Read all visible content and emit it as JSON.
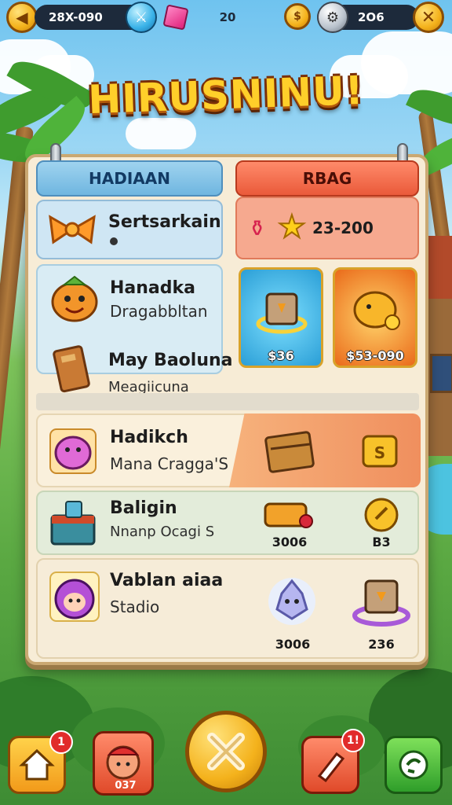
{
  "topbar": {
    "left_value": "28X-090",
    "center_value": "20",
    "right_value": "2O6"
  },
  "title": "HIRUSNINU!",
  "tabs": {
    "left": "HADIAAN",
    "right": "RBAG"
  },
  "featured": {
    "name": "Sertsarkain",
    "stars_value": "23-200"
  },
  "list_left": [
    {
      "name": "Hanadka",
      "sub": "Dragabbltan"
    },
    {
      "name": "May Baoluna",
      "sub": "Meagiicuna"
    }
  ],
  "shop_tiles": [
    {
      "price": "$36"
    },
    {
      "price": "$53-090"
    }
  ],
  "rows": [
    {
      "name": "Hadikch",
      "sub": "Mana Cragga'S",
      "price_a": "",
      "price_b": ""
    },
    {
      "name": "Baligin",
      "sub": "Nnanp Ocagi S",
      "price_a": "3006",
      "price_b": "B3"
    },
    {
      "name": "Vablan aiaa",
      "sub": "Stadio",
      "price_a": "3006",
      "price_b": "236"
    }
  ],
  "bottom_nav": {
    "home_badge": "1",
    "profile_label": "037",
    "edit_badge": "1!"
  },
  "colors": {
    "accent_gold": "#f4b21c",
    "tab_blue": "#6fb6e0",
    "tab_red": "#ea5a3a",
    "panel_bg": "#f7ecd6"
  },
  "icons": {
    "back": "arrow-left-icon",
    "gem_blue": "sword-gem-icon",
    "gem_pink": "pink-gem-icon",
    "coin": "gold-coin-icon",
    "settings": "silver-gear-icon",
    "close": "close-icon",
    "ribbon": "bow-ribbon-icon",
    "play": "play-x-icon",
    "chat": "chat-refresh-icon"
  }
}
